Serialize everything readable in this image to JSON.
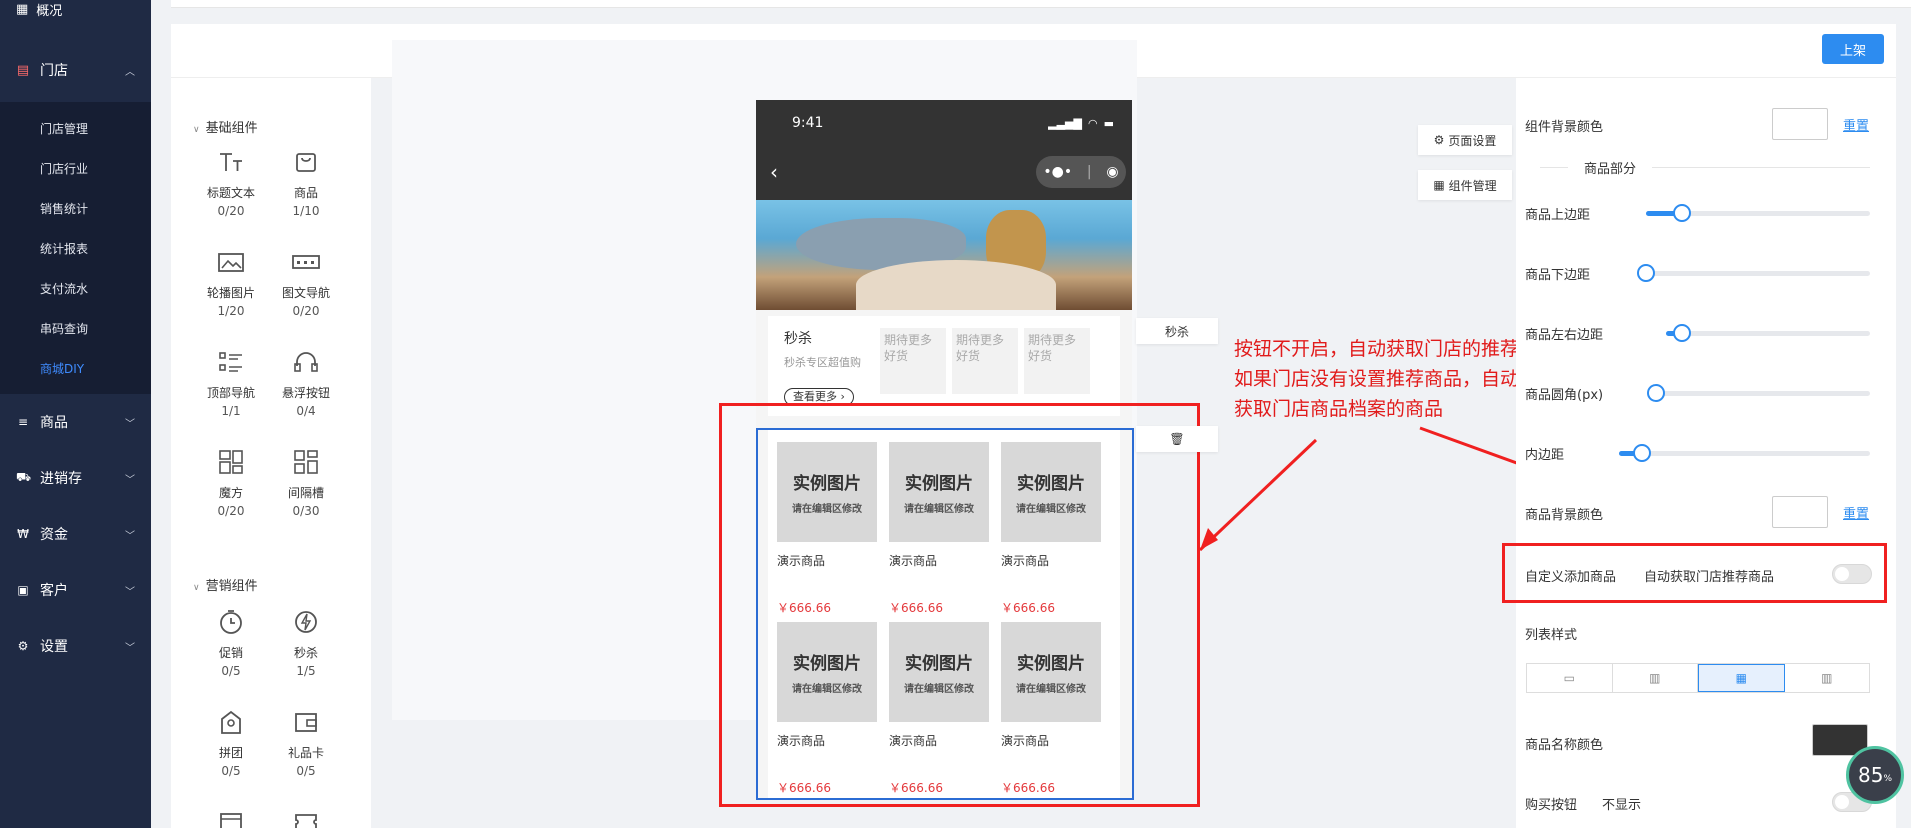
{
  "sidebar": {
    "top_label": "概况",
    "store_group": "门店",
    "store_items": [
      "门店管理",
      "门店行业",
      "销售统计",
      "统计报表",
      "支付流水",
      "串码查询",
      "商城DIY"
    ],
    "active_item": "商城DIY",
    "nav": [
      {
        "label": "商品",
        "icon": "menu-icon"
      },
      {
        "label": "进销存",
        "icon": "truck-icon"
      },
      {
        "label": "资金",
        "icon": "yen-icon"
      },
      {
        "label": "客户",
        "icon": "id-card-icon"
      },
      {
        "label": "设置",
        "icon": "gear-icon"
      }
    ]
  },
  "header": {
    "publish_label": "上架"
  },
  "components": {
    "basic_title": "基础组件",
    "basic": [
      {
        "name": "标题文本",
        "count": "0/20",
        "icon": "text-icon"
      },
      {
        "name": "商品",
        "count": "1/10",
        "icon": "bag-icon"
      },
      {
        "name": "轮播图片",
        "count": "1/20",
        "icon": "image-icon"
      },
      {
        "name": "图文导航",
        "count": "0/20",
        "icon": "nav-icon"
      },
      {
        "name": "顶部导航",
        "count": "1/1",
        "icon": "list-icon"
      },
      {
        "name": "悬浮按钮",
        "count": "0/4",
        "icon": "headset-icon"
      },
      {
        "name": "魔方",
        "count": "0/20",
        "icon": "cube-icon"
      },
      {
        "name": "间隔槽",
        "count": "0/30",
        "icon": "grid-icon"
      }
    ],
    "marketing_title": "营销组件",
    "marketing": [
      {
        "name": "促销",
        "count": "0/5",
        "icon": "timer-icon"
      },
      {
        "name": "秒杀",
        "count": "1/5",
        "icon": "flash-icon"
      },
      {
        "name": "拼团",
        "count": "0/5",
        "icon": "group-icon"
      },
      {
        "name": "礼品卡",
        "count": "0/5",
        "icon": "wallet-icon"
      }
    ]
  },
  "phone": {
    "time": "9:41",
    "seckill_title": "秒杀",
    "seckill_sub": "秒杀专区超值购",
    "seckill_more": "查看更多",
    "seckill_placeholder": "期待更多好货",
    "goods": [
      {
        "img_title": "实例图片",
        "img_sub": "请在编辑区修改",
        "name": "演示商品",
        "price": "￥666.66"
      },
      {
        "img_title": "实例图片",
        "img_sub": "请在编辑区修改",
        "name": "演示商品",
        "price": "￥666.66"
      },
      {
        "img_title": "实例图片",
        "img_sub": "请在编辑区修改",
        "name": "演示商品",
        "price": "￥666.66"
      },
      {
        "img_title": "实例图片",
        "img_sub": "请在编辑区修改",
        "name": "演示商品",
        "price": "￥666.66"
      },
      {
        "img_title": "实例图片",
        "img_sub": "请在编辑区修改",
        "name": "演示商品",
        "price": "￥666.66"
      },
      {
        "img_title": "实例图片",
        "img_sub": "请在编辑区修改",
        "name": "演示商品",
        "price": "￥666.66"
      }
    ]
  },
  "floating": {
    "page_settings": "页面设置",
    "component_manage": "组件管理",
    "seckill_tag": "秒杀"
  },
  "annotation": {
    "line1": "按钮不开启，自动获取门店的推荐商品",
    "line2": "如果门店没有设置推荐商品，自动随机",
    "line3": "获取门店商品档案的商品"
  },
  "settings": {
    "comp_bg_color": "组件背景颜色",
    "reset": "重置",
    "goods_section": "商品部分",
    "margin_top": "商品上边距",
    "margin_bottom": "商品下边距",
    "margin_lr": "商品左右边距",
    "radius": "商品圆角(px)",
    "padding": "内边距",
    "goods_bg_color": "商品背景颜色",
    "custom_add": "自定义添加商品",
    "custom_add_value": "自动获取门店推荐商品",
    "list_style": "列表样式",
    "name_color": "商品名称颜色",
    "name_color_value": "#333333",
    "buy_button": "购买按钮",
    "buy_button_value": "不显示",
    "sliders": {
      "margin_top": 0.16,
      "margin_bottom": 0.0,
      "margin_lr": 0.08,
      "radius": 0.0,
      "padding": 0.09
    }
  },
  "badge": {
    "value": "85",
    "unit": "%"
  },
  "colors": {
    "accent": "#2d8cf0",
    "sidebar": "#1f2a44",
    "annotation": "#e11b1b",
    "price": "#e4393c"
  }
}
